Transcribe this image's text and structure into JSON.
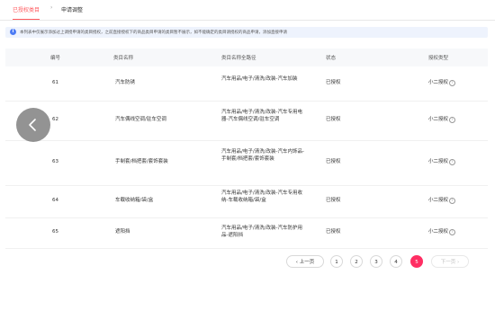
{
  "tabs": [
    {
      "label": "已授权类目",
      "active": true
    },
    {
      "label": "申请调整",
      "active": false
    }
  ],
  "breadcrumb_sep": "›",
  "notice": {
    "icon": "info-icon",
    "text": "本列表中仅展示添加过上调授申请的类目授权，之前直接授权下的商品类目申请的类目暂不展示，如不能确定的类目请授权的商品申请，添加直接申请"
  },
  "table": {
    "headers": [
      "编号",
      "类目名称",
      "类目名称全路径",
      "状态",
      "授权类型"
    ],
    "rows": [
      {
        "id": "61",
        "name": "汽车防锈",
        "path": "汽车用品/电子/清洗/改装-汽车加装",
        "status": "已授权",
        "scope": "小二授权"
      },
      {
        "id": "62",
        "name": "汽车偶线空调/驻车空调",
        "path": "汽车用品/电子/清洗/改装-汽车专用电器-汽车偶线空调/驻车空调",
        "status": "已授权",
        "scope": "小二授权"
      },
      {
        "id": "63",
        "name": "手制套/档把套/套饰套装",
        "path": "汽车用品/电子/清洗/改装-汽车内饰品-手制套/档把套/套饰套装",
        "status": "已授权",
        "scope": "小二授权"
      },
      {
        "id": "64",
        "name": "车载收纳箱/袋/盒",
        "path": "汽车用品/电子/清洗/改装-汽车专用收纳-车载收纳箱/袋/盒",
        "status": "已授权",
        "scope": "小二授权"
      },
      {
        "id": "65",
        "name": "遮阳挡",
        "path": "汽车用品/电子/清洗/改装-汽车防护用品-遮阳挡",
        "status": "已授权",
        "scope": "小二授权"
      }
    ]
  },
  "pagination": {
    "prev": "‹ 上一页",
    "pages": [
      "1",
      "2",
      "3",
      "4",
      "5"
    ],
    "current": "5",
    "next": "下一页 ›"
  },
  "colors": {
    "accent": "#ff2e63",
    "info": "#4d7cf4"
  }
}
